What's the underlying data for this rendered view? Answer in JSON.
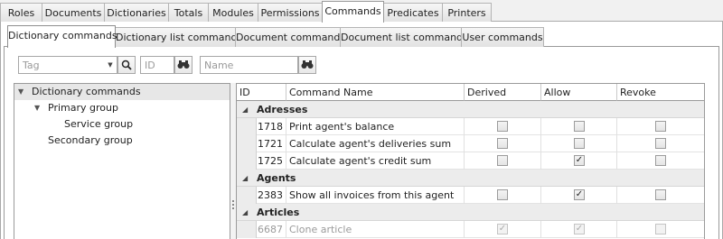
{
  "top_tabs": [
    "Roles",
    "Documents",
    "Dictionaries",
    "Totals",
    "Modules",
    "Permissions",
    "Commands",
    "Predicates",
    "Printers"
  ],
  "top_active": "Commands",
  "sub_tabs": [
    "Dictionary commands",
    "Dictionary list commands",
    "Document commands",
    "Document list commands",
    "User commands"
  ],
  "sub_active": "Dictionary commands",
  "filters": {
    "tag_placeholder": "Tag",
    "id_placeholder": "ID",
    "name_placeholder": "Name"
  },
  "tree": [
    {
      "label": "Dictionary commands",
      "level": 0,
      "expanded": true,
      "selected": true
    },
    {
      "label": "Primary group",
      "level": 1,
      "expanded": true,
      "selected": false
    },
    {
      "label": "Service group",
      "level": 2,
      "expanded": false,
      "selected": false
    },
    {
      "label": "Secondary group",
      "level": 1,
      "expanded": false,
      "selected": false
    }
  ],
  "grid": {
    "columns": [
      "ID",
      "Command Name",
      "Derived",
      "Allow",
      "Revoke"
    ],
    "groups": [
      {
        "name": "Adresses",
        "rows": [
          {
            "id": "1718",
            "name": "Print agent's balance",
            "derived": false,
            "allow": false,
            "revoke": false,
            "dim": false
          },
          {
            "id": "1721",
            "name": "Calculate agent's deliveries sum",
            "derived": false,
            "allow": false,
            "revoke": false,
            "dim": false
          },
          {
            "id": "1725",
            "name": "Calculate agent's credit sum",
            "derived": false,
            "allow": true,
            "revoke": false,
            "dim": false
          }
        ]
      },
      {
        "name": "Agents",
        "rows": [
          {
            "id": "2383",
            "name": "Show all invoices from this agent",
            "derived": false,
            "allow": true,
            "revoke": false,
            "dim": false
          }
        ]
      },
      {
        "name": "Articles",
        "rows": [
          {
            "id": "6687",
            "name": "Clone article",
            "derived": true,
            "allow": true,
            "revoke": false,
            "dim": true
          }
        ]
      }
    ]
  }
}
